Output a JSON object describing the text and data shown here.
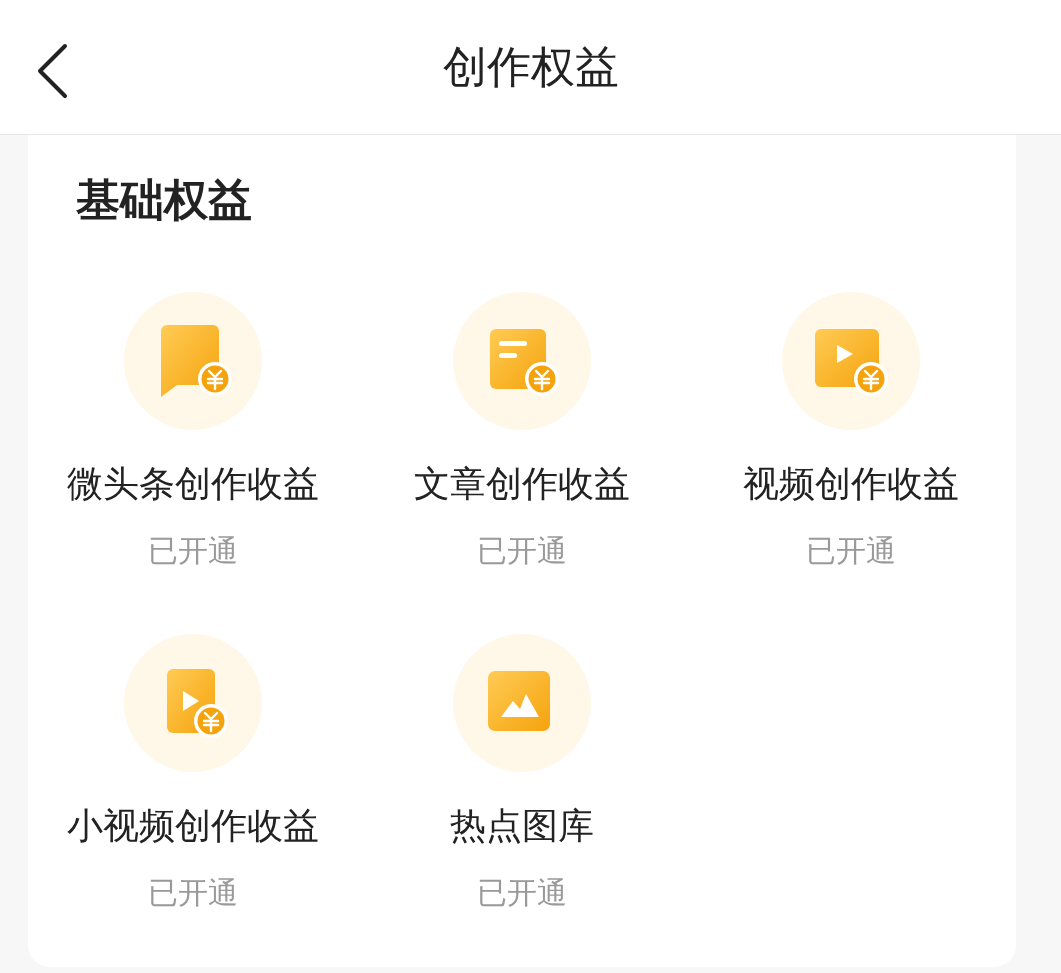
{
  "header": {
    "title": "创作权益"
  },
  "section": {
    "title": "基础权益",
    "items": [
      {
        "kind": "bubble",
        "label": "微头条创作收益",
        "status": "已开通"
      },
      {
        "kind": "article",
        "label": "文章创作收益",
        "status": "已开通"
      },
      {
        "kind": "video",
        "label": "视频创作收益",
        "status": "已开通"
      },
      {
        "kind": "short-video",
        "label": "小视频创作收益",
        "status": "已开通"
      },
      {
        "kind": "gallery",
        "label": "热点图库",
        "status": "已开通"
      }
    ]
  }
}
